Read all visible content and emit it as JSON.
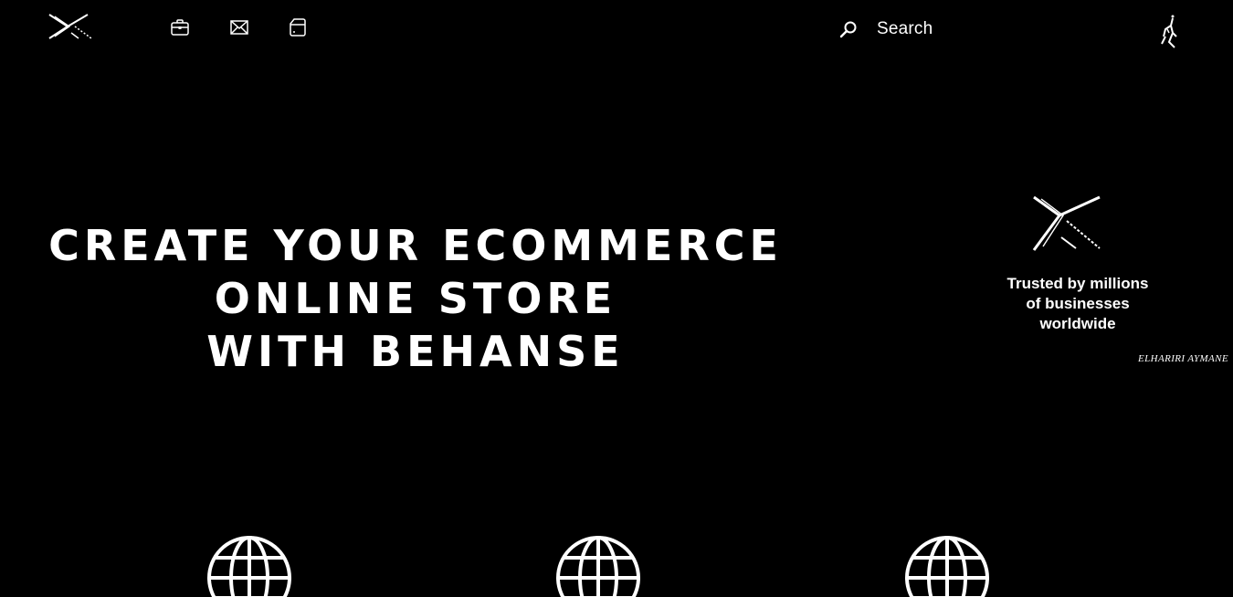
{
  "header": {
    "logo_icon": "x-chevron-logo-icon",
    "nav_icons": [
      "briefcase-icon",
      "mail-icon",
      "document-icon"
    ],
    "search": {
      "label": "Search",
      "icon": "search-icon"
    },
    "profile_icon": "figure-avatar-icon"
  },
  "hero": {
    "title_lines": [
      "CREATE YOUR ECOMMERCE",
      "ONLINE STORE",
      "WITH BEHANSE"
    ]
  },
  "badge": {
    "logo_icon": "x-chevron-logo-icon",
    "trust_lines": [
      "Trusted by millions",
      "of businesses",
      "worldwide"
    ],
    "signature": "ELHARIRI AYMANE"
  },
  "features": {
    "icons": [
      "globe-icon",
      "globe-icon",
      "globe-icon"
    ]
  },
  "colors": {
    "background": "#000000",
    "foreground": "#ffffff"
  }
}
